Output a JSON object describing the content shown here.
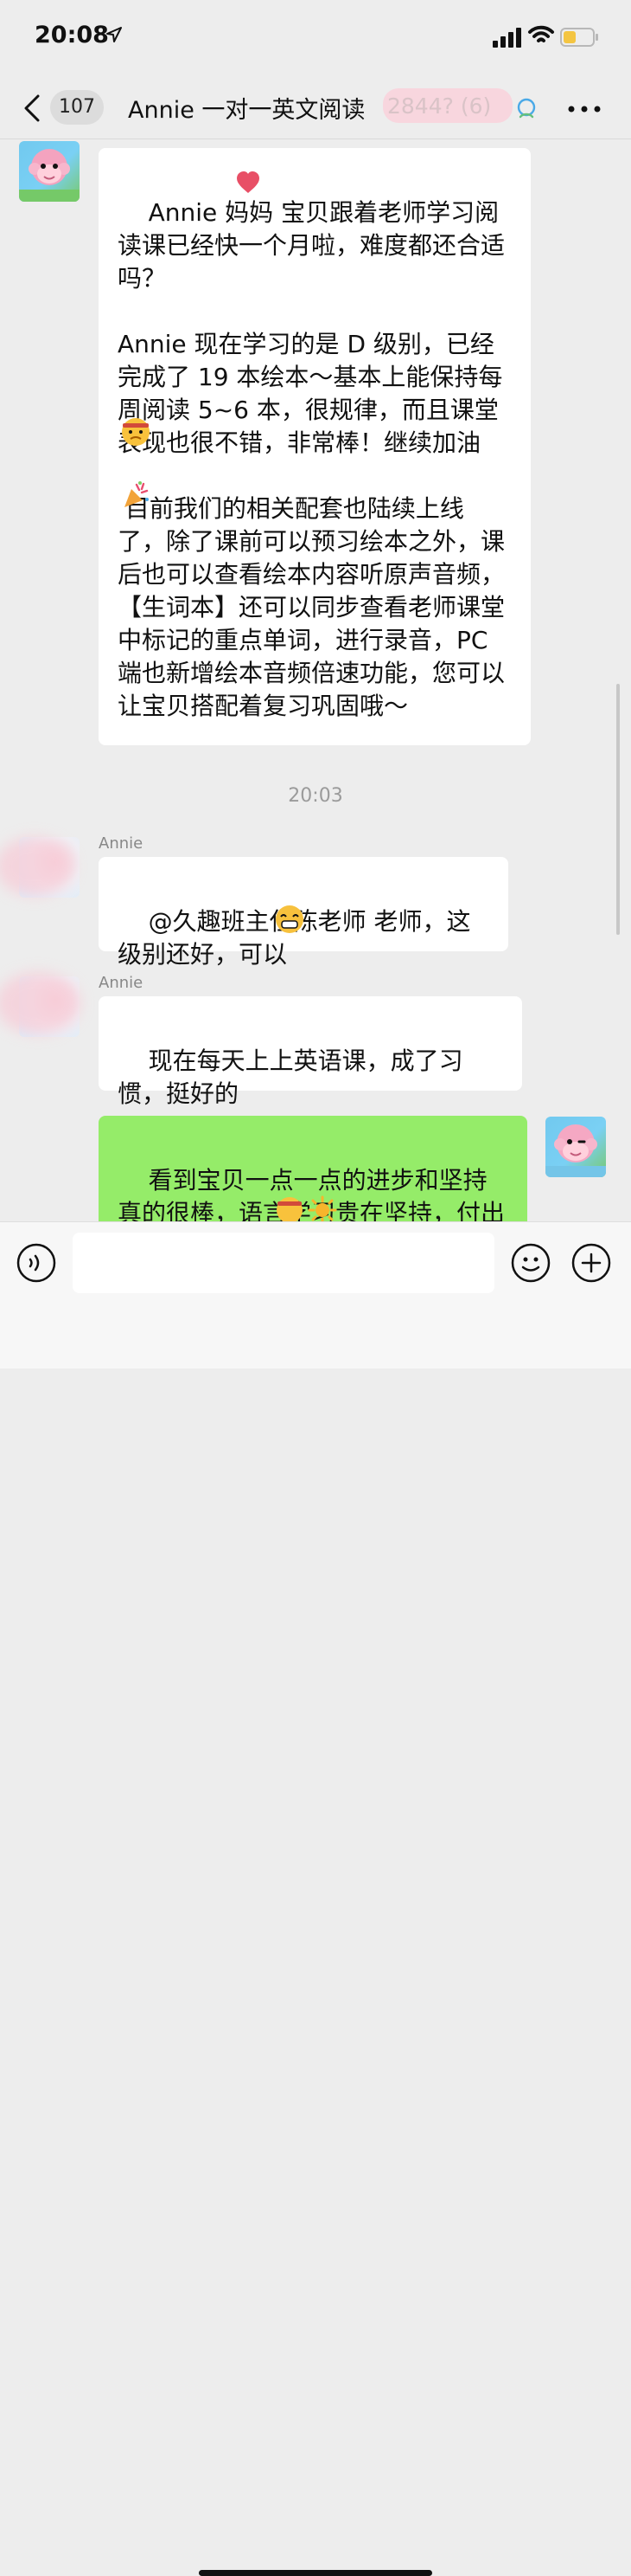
{
  "status_bar": {
    "time": "20:08",
    "icons": [
      "location-arrow-icon",
      "signal-icon",
      "wifi-icon",
      "battery-icon"
    ]
  },
  "header": {
    "unread_count": "107",
    "title": "Annie 一对一英文阅读",
    "title_hidden_suffix": "2844? (6)",
    "icons": [
      "back-icon",
      "group-chat-icon",
      "more-icon"
    ]
  },
  "messages": {
    "teacher_message": "Annie 妈妈 宝贝跟着老师学习阅读课已经快一个月啦，难度都还合适吗？\n\nAnnie 现在学习的是 D 级别，已经完成了 19 本绘本～基本上能保持每周阅读 5~6 本，很规律，而且课堂表现也很不错，非常棒！继续加油 \n\n 目前我们的相关配套也陆续上线了，除了课前可以预习绘本之外，课后也可以查看绘本内容听原声音频，【生词本】还可以同步查看老师课堂中标记的重点单词，进行录音，PC 端也新增绘本音频倍速功能，您可以让宝贝搭配着复习巩固哦～",
    "timestamp": "20:03",
    "annie_name_1": "Annie",
    "annie_message_1": "@久趣班主任陈老师 老师，这级别还好，可以",
    "annie_name_2": "Annie",
    "annie_message_2": "现在每天上上英语课，成了习惯，挺好的",
    "teacher_reply": "看到宝贝一点一点的进步和坚持真的很棒，语言学习贵在坚持，付出一定会有收获"
  },
  "input_bar": {
    "icons": [
      "voice-icon",
      "emoji-icon",
      "add-icon"
    ]
  }
}
